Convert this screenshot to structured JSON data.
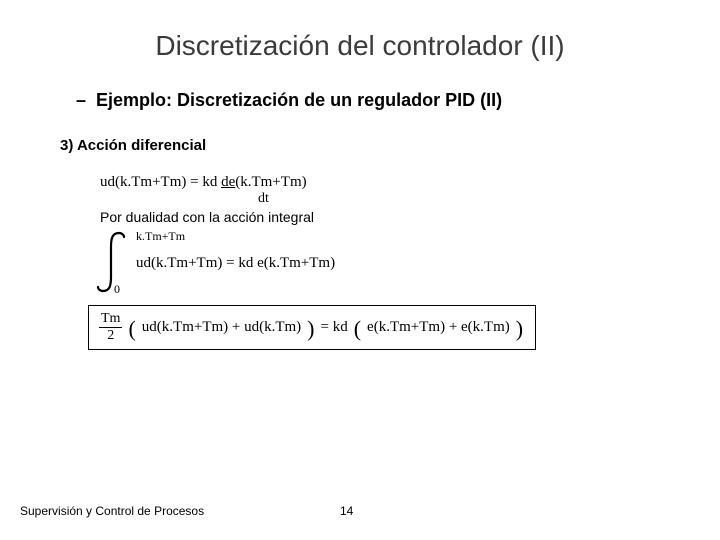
{
  "title": "Discretización del controlador (II)",
  "bullet": {
    "dash": "–",
    "text": "Ejemplo: Discretización de un regulador PID (II)"
  },
  "section_label": "3) Acción diferencial",
  "eq1": {
    "lhs": "ud(k.Tm+Tm) = kd ",
    "ul": "de",
    "rhs": "(k.Tm+Tm)",
    "dt": "dt"
  },
  "duality": "Por dualidad con la acción integral",
  "integral": {
    "upper": "k.Tm+Tm",
    "body": "ud(k.Tm+Tm) = kd e(k.Tm+Tm)",
    "lower": "0"
  },
  "boxed": {
    "frac_num": "Tm",
    "frac_den": "2",
    "left_inner": "ud(k.Tm+Tm) + ud(k.Tm)",
    "mid": " = kd ",
    "right_inner": " e(k.Tm+Tm) + e(k.Tm)"
  },
  "footer": {
    "left": "Supervisión y Control de Procesos",
    "page": "14"
  }
}
